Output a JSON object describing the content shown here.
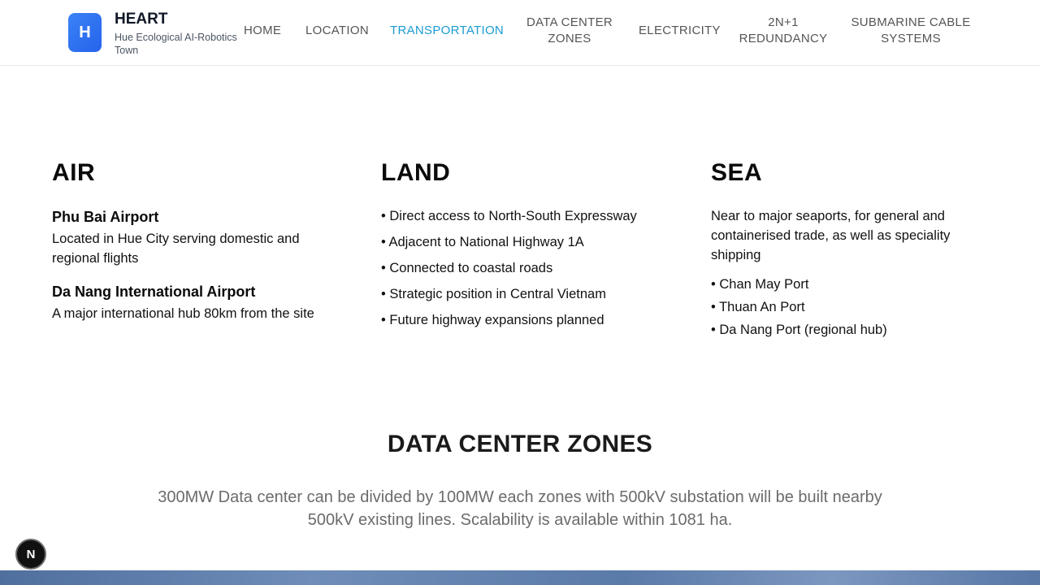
{
  "brand": {
    "logo_letter": "H",
    "title": "HEART",
    "subtitle": "Hue Ecological AI-Robotics Town"
  },
  "nav": {
    "home": "HOME",
    "location": "LOCATION",
    "transportation": "TRANSPORTATION",
    "data_center_line1": "DATA CENTER",
    "data_center_line2": "ZONES",
    "electricity": "ELECTRICITY",
    "redundancy_line1": "2N+1",
    "redundancy_line2": "REDUNDANCY",
    "submarine_line1": "SUBMARINE CABLE",
    "submarine_line2": "SYSTEMS",
    "active": "TRANSPORTATION",
    "active_color": "#1a9bd1"
  },
  "air": {
    "heading": "AIR",
    "airports": [
      {
        "name": "Phu Bai Airport",
        "description": "Located in Hue City serving domestic and regional flights"
      },
      {
        "name": "Da Nang International Airport",
        "description": "A major international hub 80km from the site"
      }
    ]
  },
  "land": {
    "heading": "LAND",
    "items": [
      "• Direct access to North-South Expressway",
      "• Adjacent to National Highway 1A",
      "• Connected to coastal roads",
      "• Strategic position in Central Vietnam",
      "• Future highway expansions planned"
    ]
  },
  "sea": {
    "heading": "SEA",
    "intro": "Near to major seaports, for general and containerised trade, as well as speciality shipping",
    "ports": [
      "• Chan May Port",
      "• Thuan An Port",
      "• Da Nang Port (regional hub)"
    ]
  },
  "data_center": {
    "title": "DATA CENTER ZONES",
    "description": "300MW Data center can be divided by 100MW each zones with 500kV substation will be built nearby 500kV existing lines. Scalability is available within 1081 ha."
  },
  "badge": {
    "letter": "N"
  }
}
